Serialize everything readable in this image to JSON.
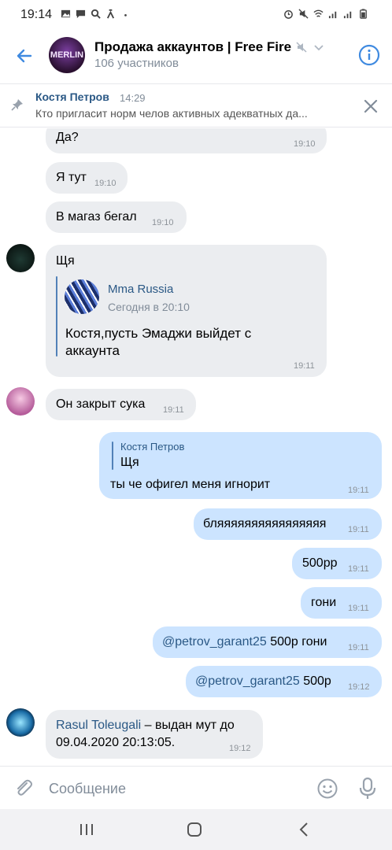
{
  "status": {
    "time": "19:14",
    "left_icons": [
      "gallery-icon",
      "message-icon",
      "search-icon",
      "tune-icon",
      "dot-icon"
    ],
    "right_icons": [
      "alarm-icon",
      "mute-icon",
      "wifi-icon",
      "signal-icon",
      "signal-icon",
      "battery-icon"
    ]
  },
  "header": {
    "title": "Продажа аккаунтов | Free Fire",
    "subtitle": "106 участников",
    "avatar_text": "MERLIN"
  },
  "pinned": {
    "author": "Костя Петров",
    "time": "14:29",
    "text": "Кто пригласит норм челов активных адекватных да..."
  },
  "messages": [
    {
      "id": "m1",
      "text": "Да?",
      "time": "19:10"
    },
    {
      "id": "m2",
      "text": "Я тут",
      "time": "19:10"
    },
    {
      "id": "m3",
      "text": "В магаз бегал",
      "time": "19:10"
    },
    {
      "id": "m4",
      "text": "Щя",
      "time": "19:11",
      "forward": {
        "author": "Mma Russia",
        "date": "Сегодня в 20:10",
        "text_line1": "Костя,пусть Эмаджи выйдет с",
        "text_line2": "аккаунта"
      }
    },
    {
      "id": "m5",
      "text": "Он закрыт сука",
      "time": "19:11"
    },
    {
      "id": "m6",
      "time": "19:11",
      "reply_author": "Костя Петров",
      "reply_text": "Щя",
      "text": "ты че офигел меня игнорит"
    },
    {
      "id": "m7",
      "text": "бляяяяяяяяяяяяяяяя",
      "time": "19:11"
    },
    {
      "id": "m8",
      "text": "500рр",
      "time": "19:11"
    },
    {
      "id": "m9",
      "text": "гони",
      "time": "19:11"
    },
    {
      "id": "m10",
      "mention": "@petrov_garant25",
      "text": " 500р гони",
      "time": "19:11"
    },
    {
      "id": "m11",
      "mention": "@petrov_garant25",
      "text": " 500р",
      "time": "19:12"
    },
    {
      "id": "m12",
      "time": "19:12",
      "author": "Rasul Toleugali",
      "text_line1": " – выдан мут до",
      "text_line2": "09.04.2020 20:13:05."
    }
  ],
  "composer": {
    "placeholder": "Сообщение"
  },
  "colors": {
    "accent": "#2a5885",
    "incoming_bubble": "#ebedf0",
    "outgoing_bubble": "#cce4ff",
    "icon_blue": "#3f8ae0"
  }
}
